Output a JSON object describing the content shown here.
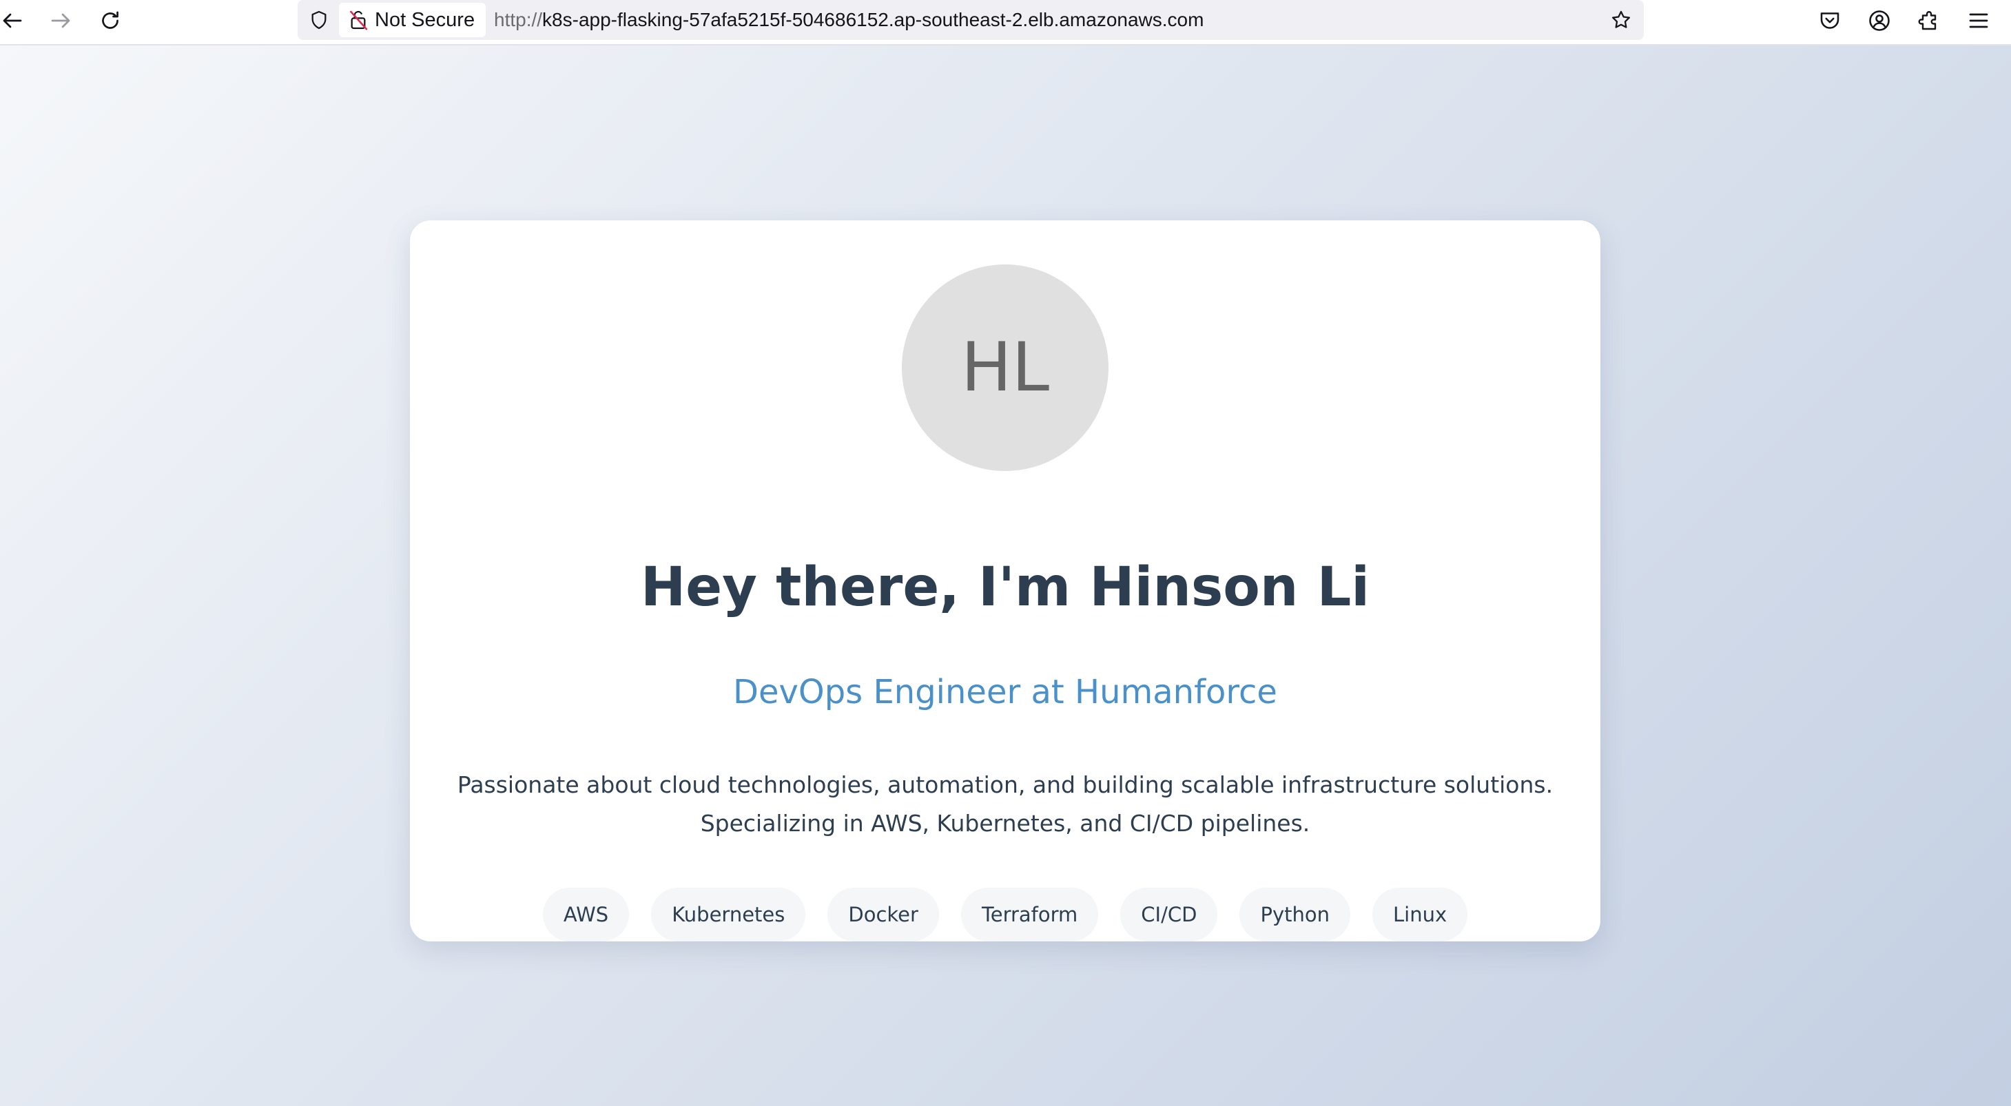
{
  "browser": {
    "back_icon": "arrow-left-icon",
    "forward_icon": "arrow-right-icon",
    "reload_icon": "reload-icon",
    "security_label": "Not Secure",
    "url_scheme": "http://",
    "url_host": "k8s-app-flasking-57afa5215f-504686152.ap-southeast-2.elb.amazonaws.com",
    "bookmark_icon": "star-icon",
    "extension_icons": [
      "pocket-icon",
      "account-icon",
      "extensions-icon",
      "menu-icon"
    ]
  },
  "profile": {
    "initials": "HL",
    "heading": "Hey there, I'm Hinson Li",
    "role": "DevOps Engineer at Humanforce",
    "bio_lines": [
      "Passionate about cloud technologies, automation, and building scalable infrastructure solutions.",
      "Specializing in AWS, Kubernetes, and CI/CD pipelines."
    ],
    "skills": [
      "AWS",
      "Kubernetes",
      "Docker",
      "Terraform",
      "CI/CD",
      "Python",
      "Linux"
    ]
  },
  "colors": {
    "heading": "#2c3e50",
    "accent": "#4a90c9",
    "avatar_bg": "#e0e0e0",
    "page_gradient_start": "#f5f7fa",
    "page_gradient_end": "#c3cfe2"
  }
}
